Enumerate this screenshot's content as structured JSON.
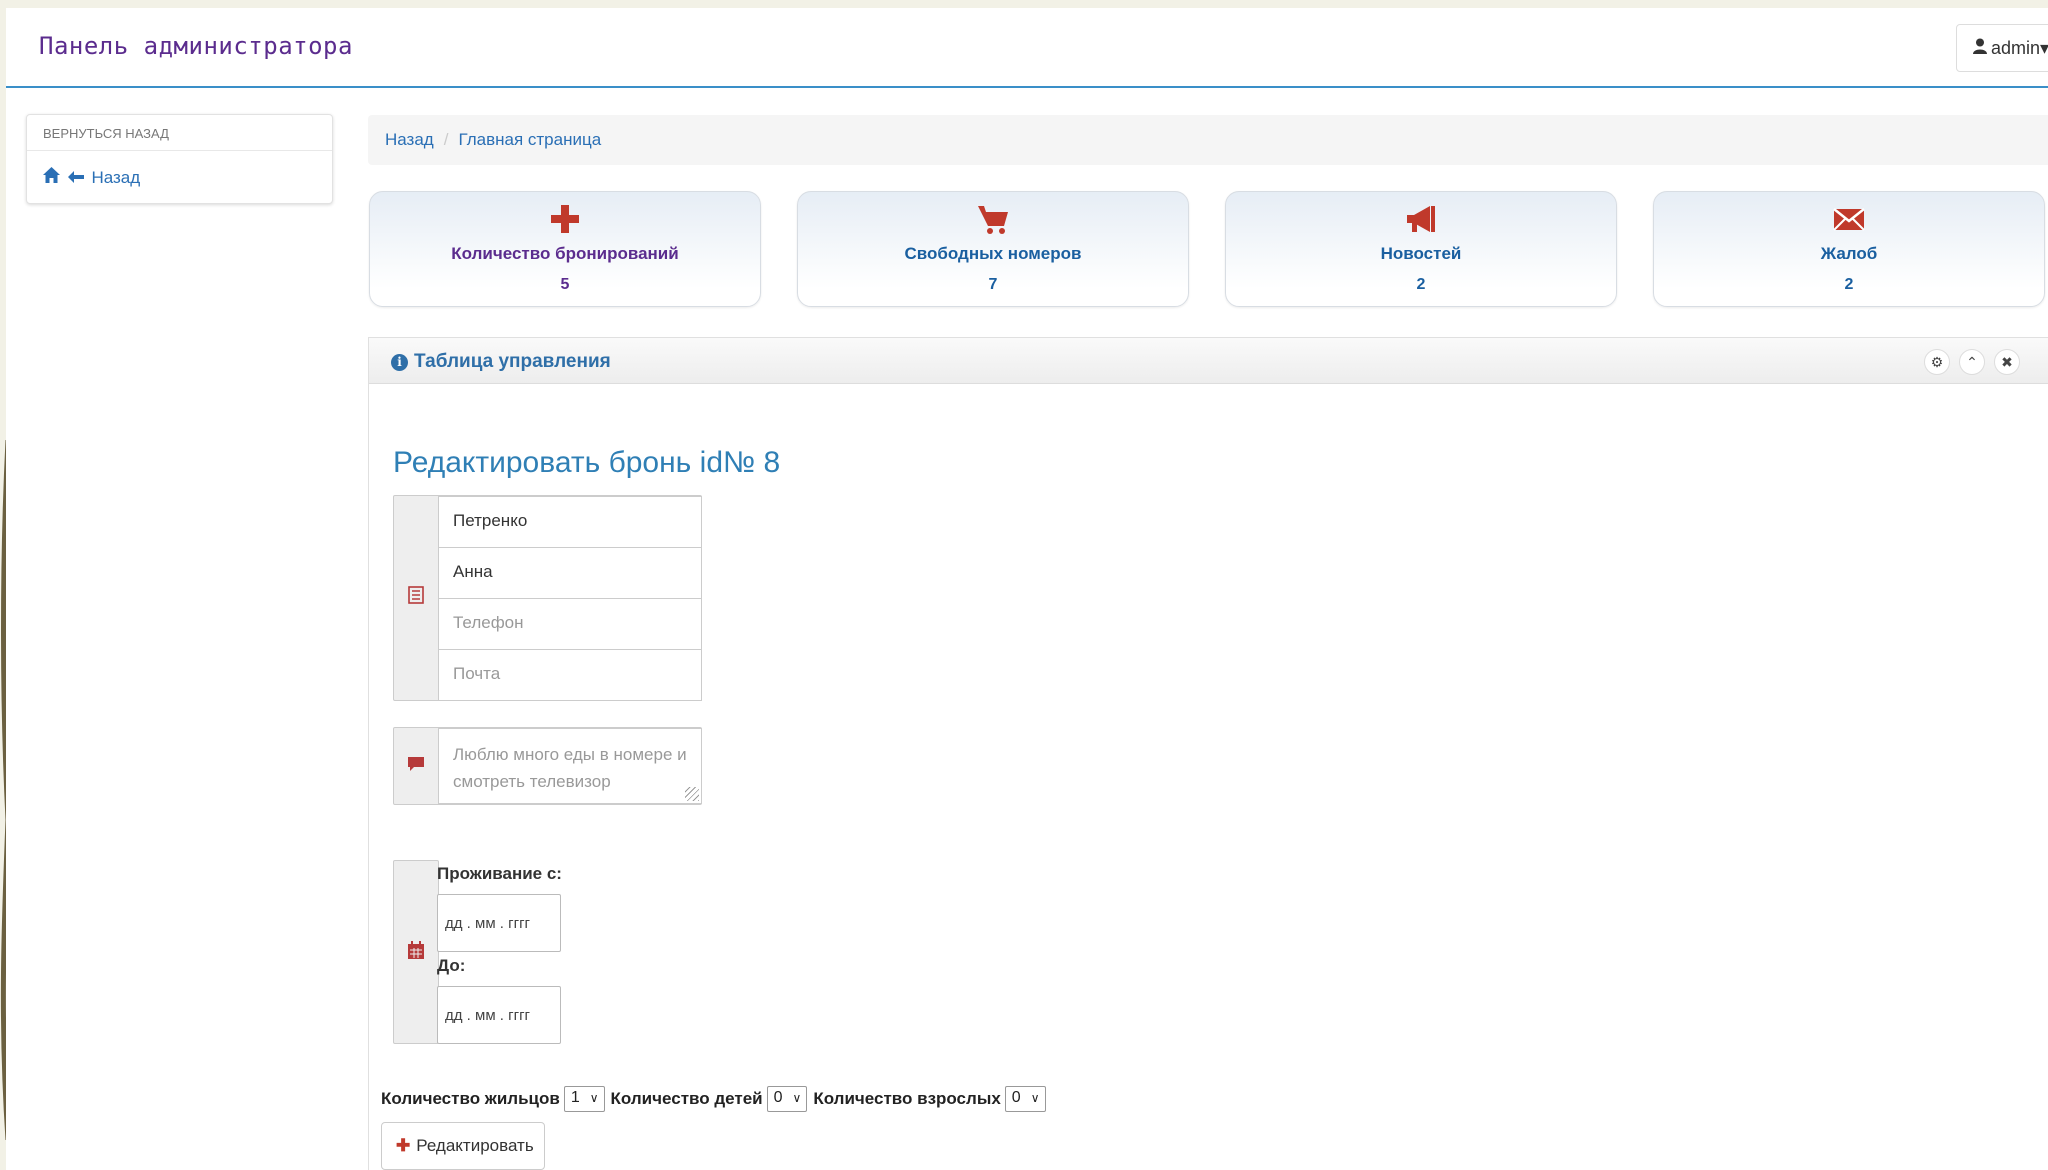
{
  "navbar": {
    "brand": "Панель администратора",
    "user_label": "admin",
    "user_caret": "▾"
  },
  "sidebar": {
    "heading": "ВЕРНУТЬСЯ НАЗАД",
    "back_link": "Назад"
  },
  "breadcrumb": {
    "items": [
      "Назад",
      "Главная страница"
    ],
    "separator": "/"
  },
  "stats": [
    {
      "label": "Количество бронирований",
      "value": "5",
      "icon": "plus-icon",
      "color": "#5b2c8e"
    },
    {
      "label": "Свободных номеров",
      "value": "7",
      "icon": "cart-icon",
      "color": "#1a5fa0"
    },
    {
      "label": "Новостей",
      "value": "2",
      "icon": "megaphone-icon",
      "color": "#1a5fa0"
    },
    {
      "label": "Жалоб",
      "value": "2",
      "icon": "envelope-icon",
      "color": "#1a5fa0"
    }
  ],
  "panel": {
    "title": "Таблица управления",
    "info_glyph": "i",
    "buttons": {
      "settings": "⚙",
      "collapse": "⌃",
      "close": "✖"
    }
  },
  "form": {
    "heading": "Редактировать бронь id№ 8",
    "surname_value": "Петренко",
    "name_value": "Анна",
    "phone_placeholder": "Телефон",
    "email_placeholder": "Почта",
    "comment_placeholder": "Люблю много еды в номере и смотреть телевизор",
    "date_from_label": "Проживание с:",
    "date_to_label": "До:",
    "date_placeholder": "дд . мм . гггг",
    "residents_label": "Количество жильцов",
    "residents_value": "1",
    "children_label": "Количество детей",
    "children_value": "0",
    "adults_label": "Количество взрослых",
    "adults_value": "0",
    "submit_label": "Редактировать"
  },
  "colors": {
    "accent_red": "#b63a3a",
    "link_blue": "#2a6fb5",
    "navbar_border": "#3a8fc8"
  }
}
